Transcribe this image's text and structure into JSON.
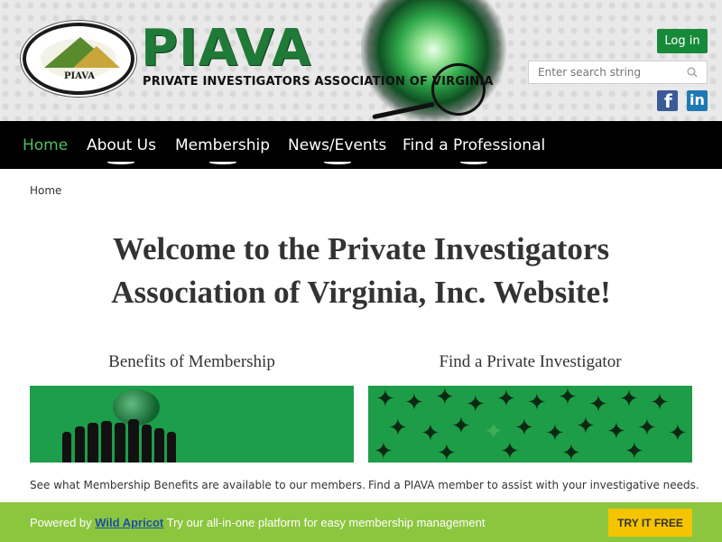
{
  "header": {
    "brand": "PIAVA",
    "tagline": "PRIVATE INVESTIGATORS ASSOCIATION OF VIRGINIA",
    "seal_text": "PIAVA",
    "seal_ring": "PRIVATE INVESTIGATORS ASSOCIATION OF VIRGINIA",
    "login_label": "Log in",
    "search_placeholder": "Enter search string",
    "social": [
      "facebook-icon",
      "linkedin-icon"
    ],
    "brand_color": "#1f7a37"
  },
  "nav": {
    "items": [
      {
        "label": "Home",
        "active": true
      },
      {
        "label": "About Us",
        "active": false
      },
      {
        "label": "Membership",
        "active": false
      },
      {
        "label": "News/Events",
        "active": false
      },
      {
        "label": "Find a Professional",
        "active": false
      }
    ],
    "active_color": "#4fbe60"
  },
  "breadcrumb": "Home",
  "main": {
    "headline_line1": "Welcome to the Private Investigators",
    "headline_line2": "Association of Virginia, Inc. Website!",
    "columns": [
      {
        "title": "Benefits of Membership",
        "description": "See what Membership Benefits are available to our members."
      },
      {
        "title": "Find a Private Investigator",
        "description": "Find a PIAVA member to assist with your investigative needs."
      }
    ]
  },
  "footer": {
    "powered_prefix": "Powered by",
    "powered_link": "Wild Apricot",
    "powered_suffix": "Try our all-in-one platform for easy membership management",
    "cta_label": "TRY IT FREE",
    "bar_color": "#8cc63f",
    "cta_color": "#f5c400"
  }
}
